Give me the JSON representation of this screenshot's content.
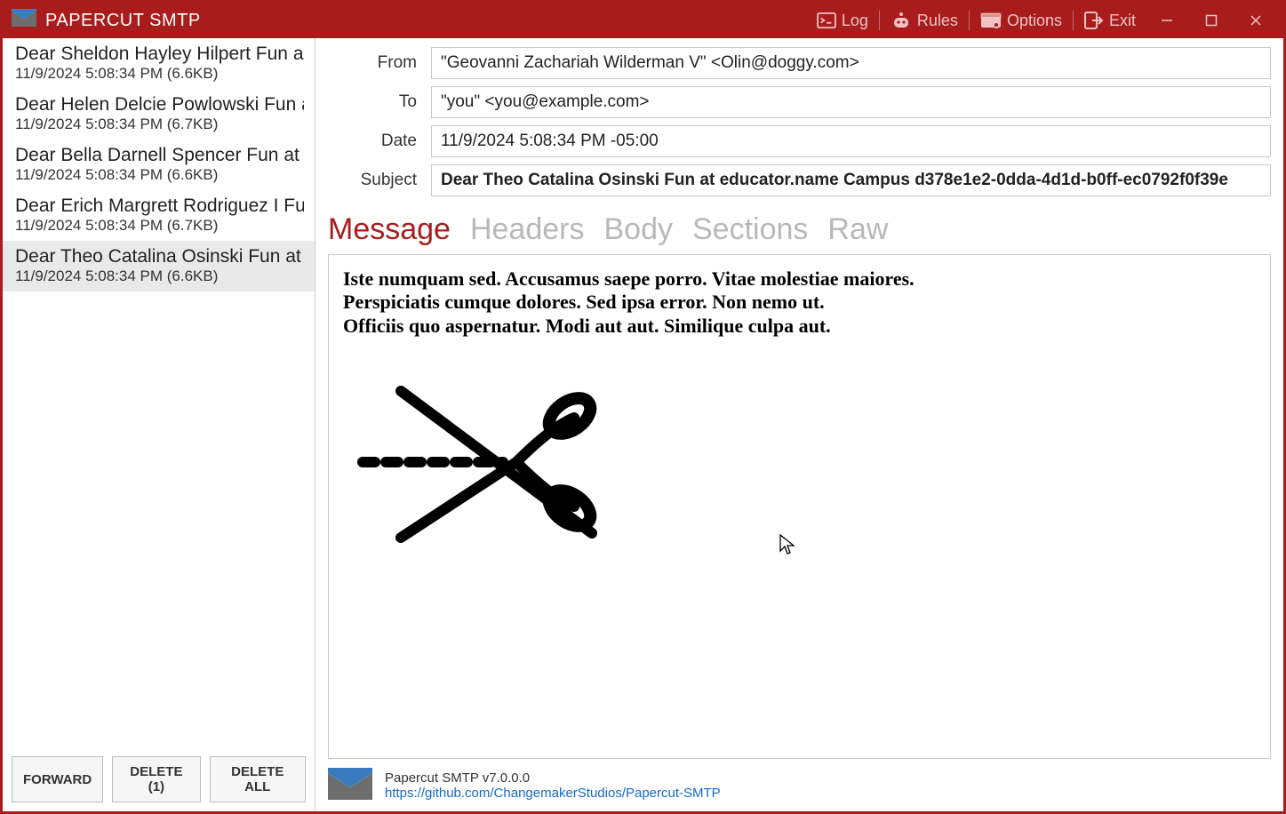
{
  "app": {
    "title": "PAPERCUT SMTP"
  },
  "titlebar": {
    "log": "Log",
    "rules": "Rules",
    "options": "Options",
    "exit": "Exit"
  },
  "sidebar": {
    "items": [
      {
        "subject": "Dear Sheldon Hayley Hilpert Fun at e…",
        "meta": "11/9/2024 5:08:34 PM (6.6KB)",
        "selected": false
      },
      {
        "subject": "Dear Helen Delcie Powlowski Fun at e",
        "meta": "11/9/2024 5:08:34 PM (6.7KB)",
        "selected": false
      },
      {
        "subject": "Dear Bella Darnell Spencer Fun at edu",
        "meta": "11/9/2024 5:08:34 PM (6.6KB)",
        "selected": false
      },
      {
        "subject": "Dear Erich Margrett Rodriguez I Fun a",
        "meta": "11/9/2024 5:08:34 PM (6.7KB)",
        "selected": false
      },
      {
        "subject": "Dear Theo Catalina Osinski Fun at edu",
        "meta": "11/9/2024 5:08:34 PM (6.6KB)",
        "selected": true
      }
    ],
    "actions": {
      "forward": "FORWARD",
      "delete": "DELETE (1)",
      "deleteAll": "DELETE ALL"
    }
  },
  "headersPanel": {
    "labels": {
      "from": "From",
      "to": "To",
      "date": "Date",
      "subject": "Subject"
    },
    "from": "\"Geovanni Zachariah Wilderman V\" <Olin@doggy.com>",
    "to": "\"you\" <you@example.com>",
    "date": "11/9/2024 5:08:34 PM -05:00",
    "subject": "Dear Theo Catalina Osinski Fun at educator.name Campus d378e1e2-0dda-4d1d-b0ff-ec0792f0f39e"
  },
  "tabs": {
    "message": "Message",
    "headers": "Headers",
    "body": "Body",
    "sections": "Sections",
    "raw": "Raw"
  },
  "message": {
    "line1": "Iste numquam sed. Accusamus saepe porro. Vitae molestiae maiores.",
    "line2": "Perspiciatis cumque dolores. Sed ipsa error. Non nemo ut.",
    "line3": "Officiis quo aspernatur. Modi aut aut. Similique culpa aut."
  },
  "footer": {
    "version": "Papercut SMTP v7.0.0.0",
    "link": "https://github.com/ChangemakerStudios/Papercut-SMTP"
  }
}
